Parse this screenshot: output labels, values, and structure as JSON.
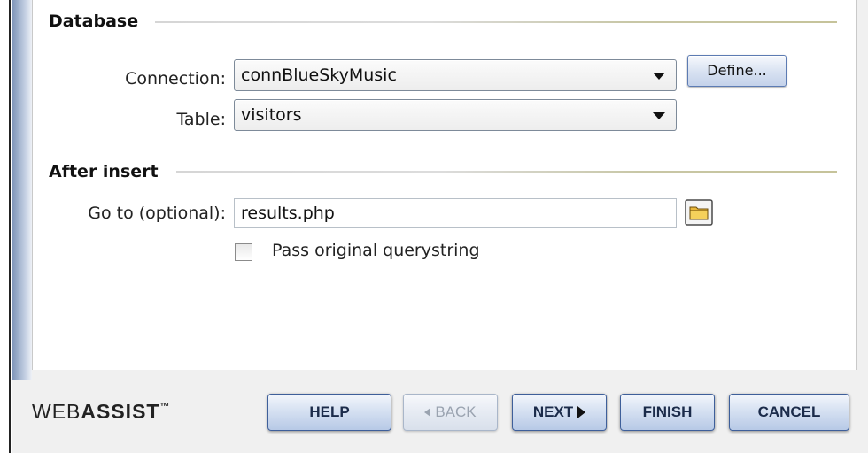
{
  "database": {
    "title": "Database",
    "connection_label": "Connection:",
    "connection_value": "connBlueSkyMusic",
    "define_label": "Define...",
    "table_label": "Table:",
    "table_value": "visitors"
  },
  "after_insert": {
    "title": "After insert",
    "goto_label": "Go to (optional):",
    "goto_value": "results.php",
    "browse_icon": "folder-icon",
    "pass_querystring_label": "Pass original querystring",
    "pass_querystring_checked": false
  },
  "footer": {
    "logo_prefix": "WEB",
    "logo_bold": "ASSIST",
    "logo_tm": "™",
    "help_label": "HELP",
    "back_label": "BACK",
    "next_label": "NEXT",
    "finish_label": "FINISH",
    "cancel_label": "CANCEL"
  }
}
